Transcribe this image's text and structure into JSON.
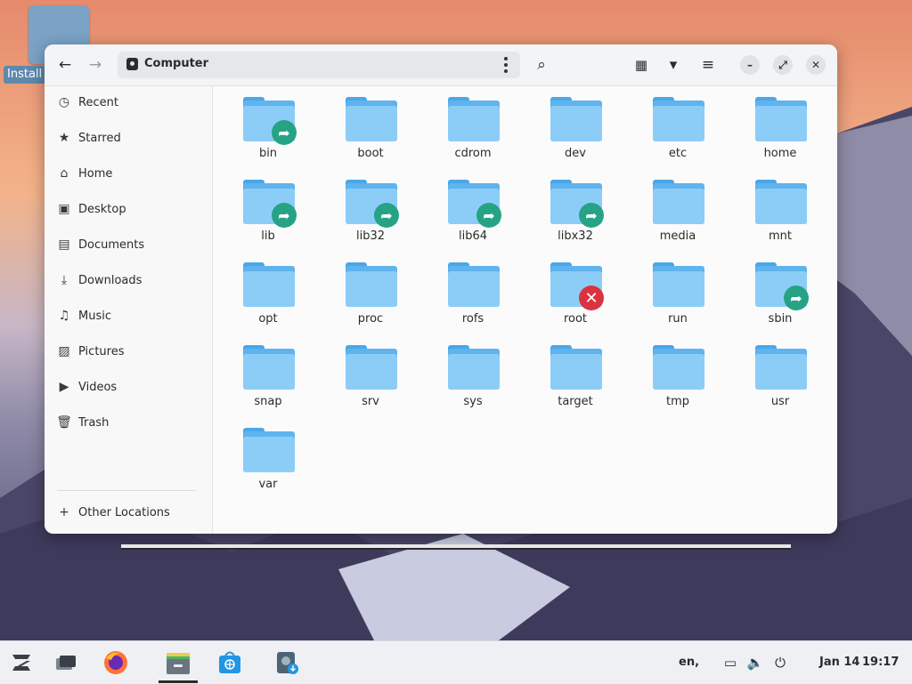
{
  "desktop": {
    "icons": [
      {
        "label": "Install Z"
      }
    ]
  },
  "window": {
    "path_title": "Computer",
    "buttons": {
      "back": "←",
      "forward": "→",
      "search": "⌕",
      "view_grid": "▦",
      "sort_dropdown": "▾",
      "menu": "≡",
      "minimize": "–",
      "maximize": "⤢",
      "close": "✕"
    }
  },
  "sidebar": {
    "items": [
      {
        "label": "Recent",
        "icon": "clock-icon"
      },
      {
        "label": "Starred",
        "icon": "star-icon"
      },
      {
        "label": "Home",
        "icon": "home-icon"
      },
      {
        "label": "Desktop",
        "icon": "desktop-icon"
      },
      {
        "label": "Documents",
        "icon": "document-icon"
      },
      {
        "label": "Downloads",
        "icon": "download-icon"
      },
      {
        "label": "Music",
        "icon": "music-icon"
      },
      {
        "label": "Pictures",
        "icon": "picture-icon"
      },
      {
        "label": "Videos",
        "icon": "video-icon"
      },
      {
        "label": "Trash",
        "icon": "trash-icon"
      }
    ],
    "other_locations": {
      "label": "Other Locations",
      "icon": "plus-icon"
    }
  },
  "files": [
    {
      "name": "bin",
      "emblem": "link"
    },
    {
      "name": "boot",
      "emblem": ""
    },
    {
      "name": "cdrom",
      "emblem": ""
    },
    {
      "name": "dev",
      "emblem": ""
    },
    {
      "name": "etc",
      "emblem": ""
    },
    {
      "name": "home",
      "emblem": ""
    },
    {
      "name": "lib",
      "emblem": "link"
    },
    {
      "name": "lib32",
      "emblem": "link"
    },
    {
      "name": "lib64",
      "emblem": "link"
    },
    {
      "name": "libx32",
      "emblem": "link"
    },
    {
      "name": "media",
      "emblem": ""
    },
    {
      "name": "mnt",
      "emblem": ""
    },
    {
      "name": "opt",
      "emblem": ""
    },
    {
      "name": "proc",
      "emblem": ""
    },
    {
      "name": "rofs",
      "emblem": ""
    },
    {
      "name": "root",
      "emblem": "noaccess"
    },
    {
      "name": "run",
      "emblem": ""
    },
    {
      "name": "sbin",
      "emblem": "link"
    },
    {
      "name": "snap",
      "emblem": ""
    },
    {
      "name": "srv",
      "emblem": ""
    },
    {
      "name": "sys",
      "emblem": ""
    },
    {
      "name": "target",
      "emblem": ""
    },
    {
      "name": "tmp",
      "emblem": ""
    },
    {
      "name": "usr",
      "emblem": ""
    },
    {
      "name": "var",
      "emblem": ""
    }
  ],
  "taskbar": {
    "apps": [
      "zorin-menu",
      "workspaces",
      "firefox",
      "files",
      "software-store",
      "installer"
    ],
    "language": "en,",
    "date": "Jan 14",
    "time": "19:17"
  },
  "colors": {
    "folder_light": "#8ccdf8",
    "folder_dark": "#5fb3ee",
    "link_emblem": "#26a385",
    "noaccess_emblem": "#d9333f"
  }
}
